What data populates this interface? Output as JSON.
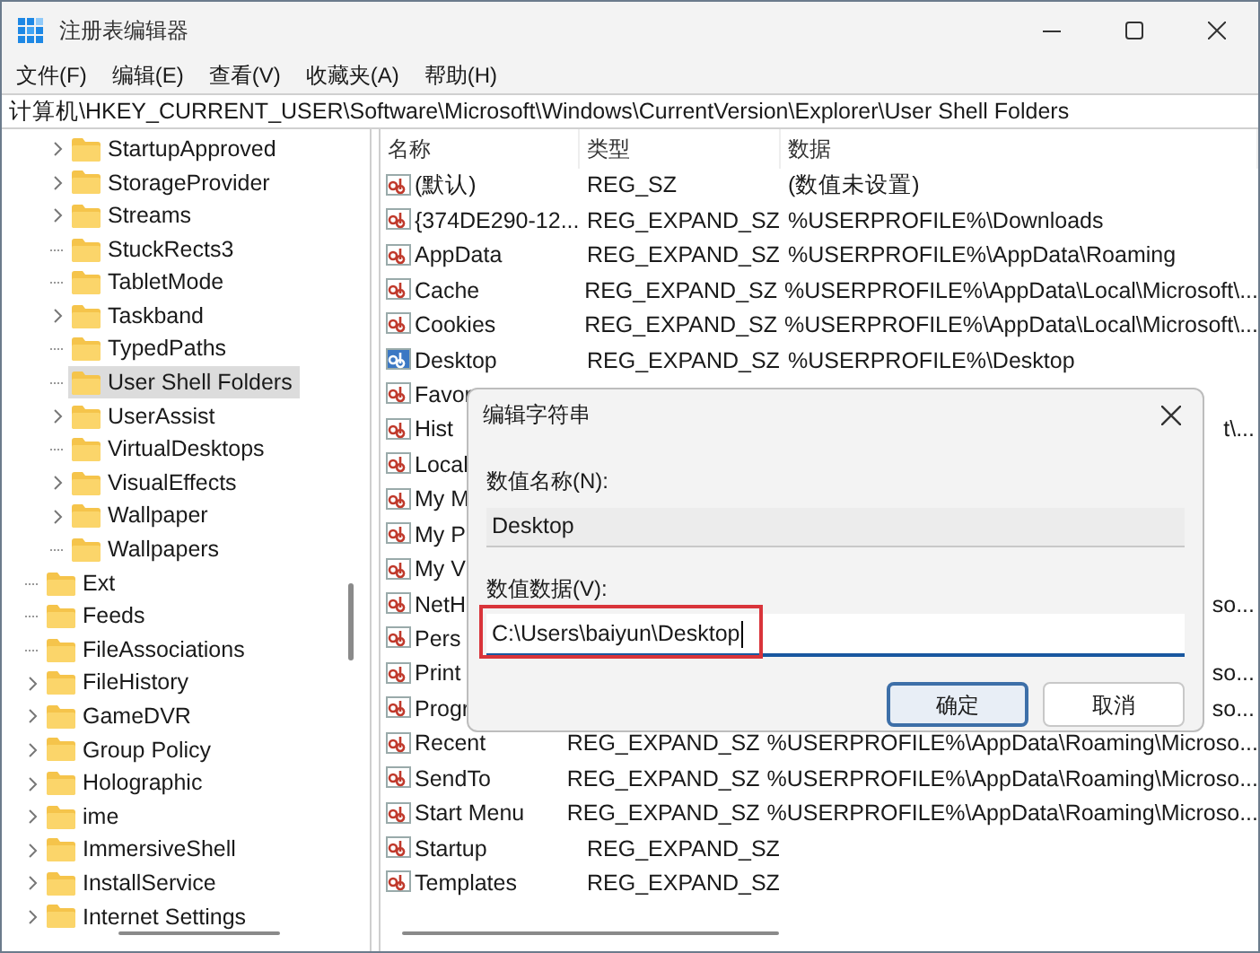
{
  "window": {
    "title": "注册表编辑器"
  },
  "menu": [
    "文件(F)",
    "编辑(E)",
    "查看(V)",
    "收藏夹(A)",
    "帮助(H)"
  ],
  "address": "计算机\\HKEY_CURRENT_USER\\Software\\Microsoft\\Windows\\CurrentVersion\\Explorer\\User Shell Folders",
  "tree": [
    {
      "children": [
        {
          "label": "StartupApproved",
          "expandable": true,
          "selected": false
        },
        {
          "label": "StorageProvider",
          "expandable": true,
          "selected": false
        },
        {
          "label": "Streams",
          "expandable": true,
          "selected": false
        },
        {
          "label": "StuckRects3",
          "expandable": false,
          "selected": false
        },
        {
          "label": "TabletMode",
          "expandable": false,
          "selected": false
        },
        {
          "label": "Taskband",
          "expandable": true,
          "selected": false
        },
        {
          "label": "TypedPaths",
          "expandable": false,
          "selected": false
        },
        {
          "label": "User Shell Folders",
          "expandable": false,
          "selected": true
        },
        {
          "label": "UserAssist",
          "expandable": true,
          "selected": false
        },
        {
          "label": "VirtualDesktops",
          "expandable": false,
          "selected": false
        },
        {
          "label": "VisualEffects",
          "expandable": true,
          "selected": false
        },
        {
          "label": "Wallpaper",
          "expandable": true,
          "selected": false
        },
        {
          "label": "Wallpapers",
          "expandable": false,
          "selected": false
        }
      ]
    },
    {
      "label": "Ext",
      "expandable": false,
      "selected": false
    },
    {
      "label": "Feeds",
      "expandable": false,
      "selected": false
    },
    {
      "label": "FileAssociations",
      "expandable": false,
      "selected": false
    },
    {
      "label": "FileHistory",
      "expandable": true,
      "selected": false
    },
    {
      "label": "GameDVR",
      "expandable": true,
      "selected": false
    },
    {
      "label": "Group Policy",
      "expandable": true,
      "selected": false
    },
    {
      "label": "Holographic",
      "expandable": true,
      "selected": false
    },
    {
      "label": "ime",
      "expandable": true,
      "selected": false
    },
    {
      "label": "ImmersiveShell",
      "expandable": true,
      "selected": false
    },
    {
      "label": "InstallService",
      "expandable": true,
      "selected": false
    },
    {
      "label": "Internet Settings",
      "expandable": true,
      "selected": false
    }
  ],
  "table": {
    "columns": [
      "名称",
      "类型",
      "数据"
    ],
    "rows": [
      {
        "name": "(默认)",
        "type": "REG_SZ",
        "data": "(数值未设置)",
        "selected": false
      },
      {
        "name": "{374DE290-12...",
        "type": "REG_EXPAND_SZ",
        "data": "%USERPROFILE%\\Downloads",
        "selected": false
      },
      {
        "name": "AppData",
        "type": "REG_EXPAND_SZ",
        "data": "%USERPROFILE%\\AppData\\Roaming",
        "selected": false
      },
      {
        "name": "Cache",
        "type": "REG_EXPAND_SZ",
        "data": "%USERPROFILE%\\AppData\\Local\\Microsoft\\...",
        "selected": false
      },
      {
        "name": "Cookies",
        "type": "REG_EXPAND_SZ",
        "data": "%USERPROFILE%\\AppData\\Local\\Microsoft\\...",
        "selected": false
      },
      {
        "name": "Desktop",
        "type": "REG_EXPAND_SZ",
        "data": "%USERPROFILE%\\Desktop",
        "selected": true
      },
      {
        "name": "Favor",
        "selected": false
      },
      {
        "name": "Hist",
        "data_tail": "t\\...",
        "selected": false
      },
      {
        "name": "Local",
        "selected": false
      },
      {
        "name": "My M",
        "selected": false
      },
      {
        "name": "My P",
        "selected": false
      },
      {
        "name": "My V",
        "selected": false
      },
      {
        "name": "NetH",
        "data_tail": "so...",
        "selected": false
      },
      {
        "name": "Pers",
        "selected": false
      },
      {
        "name": "Print",
        "data_tail": "so...",
        "selected": false
      },
      {
        "name": "Progr",
        "data_tail": "so...",
        "selected": false
      },
      {
        "name": "Recent",
        "type": "REG_EXPAND_SZ",
        "data": "%USERPROFILE%\\AppData\\Roaming\\Microso...",
        "selected": false
      },
      {
        "name": "SendTo",
        "type": "REG_EXPAND_SZ",
        "data": "%USERPROFILE%\\AppData\\Roaming\\Microso...",
        "selected": false
      },
      {
        "name": "Start Menu",
        "type": "REG_EXPAND_SZ",
        "data": "%USERPROFILE%\\AppData\\Roaming\\Microso...",
        "selected": false
      },
      {
        "name": "Startup",
        "type": "REG_EXPAND_SZ",
        "selected": false
      },
      {
        "name": "Templates",
        "type": "REG_EXPAND_SZ",
        "selected": false
      }
    ]
  },
  "dialog": {
    "title": "编辑字符串",
    "name_label": "数值名称(N):",
    "name_value": "Desktop",
    "data_label": "数值数据(V):",
    "data_value": "C:\\Users\\baiyun\\Desktop",
    "highlighted": true,
    "buttons": [
      {
        "label": "确定",
        "default": true
      },
      {
        "label": "取消",
        "default": false
      }
    ]
  }
}
